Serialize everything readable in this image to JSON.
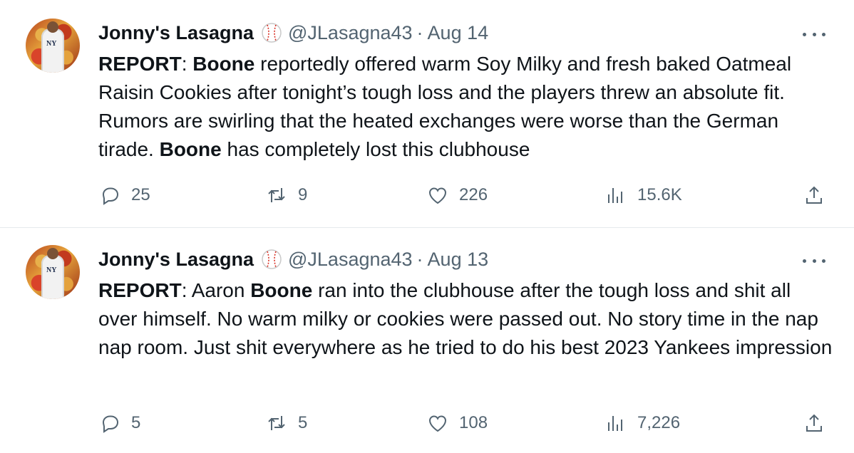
{
  "tweets": [
    {
      "author_name": "Jonny's Lasagna",
      "handle": "@JLasagna43",
      "separator": "·",
      "date": "Aug 14",
      "text_parts": [
        {
          "text": "REPORT",
          "bold": true
        },
        {
          "text": ": ",
          "bold": false
        },
        {
          "text": "Boone",
          "bold": true
        },
        {
          "text": " reportedly offered warm Soy Milky and fresh baked Oatmeal Raisin Cookies after tonight’s tough loss and the players threw an absolute fit. Rumors are swirling that the heated exchanges were worse than the German tirade. ",
          "bold": false
        },
        {
          "text": "Boone",
          "bold": true
        },
        {
          "text": " has completely lost this clubhouse",
          "bold": false
        }
      ],
      "replies": "25",
      "retweets": "9",
      "likes": "226",
      "views": "15.6K"
    },
    {
      "author_name": "Jonny's Lasagna",
      "handle": "@JLasagna43",
      "separator": "·",
      "date": "Aug 13",
      "text_parts": [
        {
          "text": "REPORT",
          "bold": true
        },
        {
          "text": ": Aaron ",
          "bold": false
        },
        {
          "text": "Boone",
          "bold": true
        },
        {
          "text": " ran into the clubhouse after the tough loss and shit all over himself. No warm milky or cookies were passed out. No story time in the nap nap room. Just shit everywhere as he tried to do his best 2023 Yankees impression",
          "bold": false
        }
      ],
      "replies": "5",
      "retweets": "5",
      "likes": "108",
      "views": "7,226"
    }
  ],
  "icons": {
    "badge": "baseball-icon",
    "more": "more-options-icon",
    "reply": "reply-icon",
    "retweet": "retweet-icon",
    "like": "heart-icon",
    "views": "views-icon",
    "share": "share-icon"
  },
  "colors": {
    "text": "#0f1419",
    "secondary": "#536471",
    "divider": "#e6e9ec",
    "baseball_stitch": "#d93025"
  }
}
